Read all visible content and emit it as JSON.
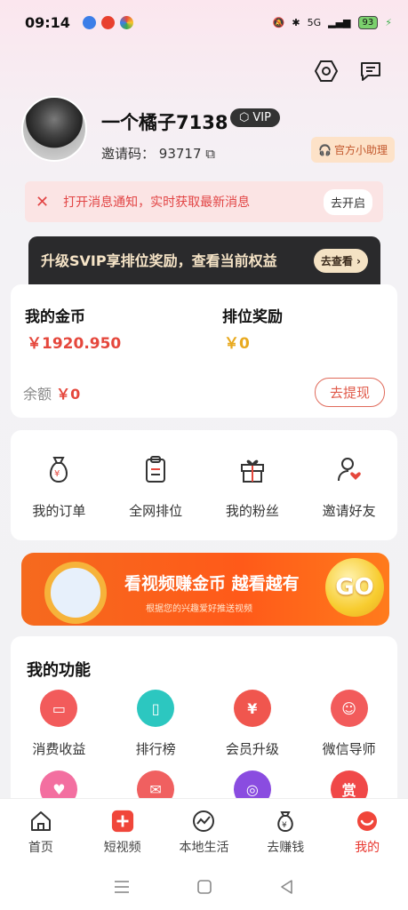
{
  "status": {
    "time": "09:14",
    "battery": "93",
    "network": "5G"
  },
  "profile": {
    "username": "一个橘子7138",
    "vip_label": "VIP",
    "invite_label": "邀请码：",
    "invite_code": "93717",
    "helper_label": "官方小助理"
  },
  "notice": {
    "text": "打开消息通知，实时获取最新消息",
    "button": "去开启"
  },
  "svip": {
    "text": "升级SVIP享排位奖励，查看当前权益",
    "button": "去查看"
  },
  "gold": {
    "coin_label": "我的金币",
    "coin_value": "￥1920.950",
    "rank_label": "排位奖励",
    "rank_value": "￥0",
    "balance_label": "余额",
    "balance_value": "￥0",
    "withdraw": "去提现"
  },
  "menu": [
    {
      "label": "我的订单",
      "icon": "money-bag-icon"
    },
    {
      "label": "全网排位",
      "icon": "clipboard-icon"
    },
    {
      "label": "我的粉丝",
      "icon": "gift-icon"
    },
    {
      "label": "邀请好友",
      "icon": "user-heart-icon"
    }
  ],
  "promo": {
    "title": "看视频赚金币 越看越有",
    "subtitle": "根据您的兴趣爱好推送视频",
    "go": "GO"
  },
  "functions": {
    "title": "我的功能",
    "items": [
      {
        "label": "消费收益",
        "icon": "card-icon",
        "color": "#f25b5b"
      },
      {
        "label": "排行榜",
        "icon": "phone-icon",
        "color": "#2cc7c0"
      },
      {
        "label": "会员升级",
        "icon": "upgrade-icon",
        "color": "#f0564e"
      },
      {
        "label": "微信导师",
        "icon": "smile-icon",
        "color": "#f25b5b"
      },
      {
        "label": "",
        "icon": "heart-icon",
        "color": "#f36fa0"
      },
      {
        "label": "",
        "icon": "envelope-icon",
        "color": "#f06060"
      },
      {
        "label": "",
        "icon": "coin-icon",
        "color": "#8a4ce0"
      },
      {
        "label": "",
        "icon": "reward-icon",
        "color": "#f04848"
      }
    ],
    "reward_char": "赏"
  },
  "tabs": [
    {
      "label": "首页",
      "icon": "home-icon"
    },
    {
      "label": "短视频",
      "icon": "plus-video-icon"
    },
    {
      "label": "本地生活",
      "icon": "trend-icon"
    },
    {
      "label": "去赚钱",
      "icon": "money-icon"
    },
    {
      "label": "我的",
      "icon": "me-icon"
    }
  ],
  "colors": {
    "accent": "#e8362e",
    "gold": "#e8a91e",
    "dark_banner": "#2a2a2c"
  }
}
